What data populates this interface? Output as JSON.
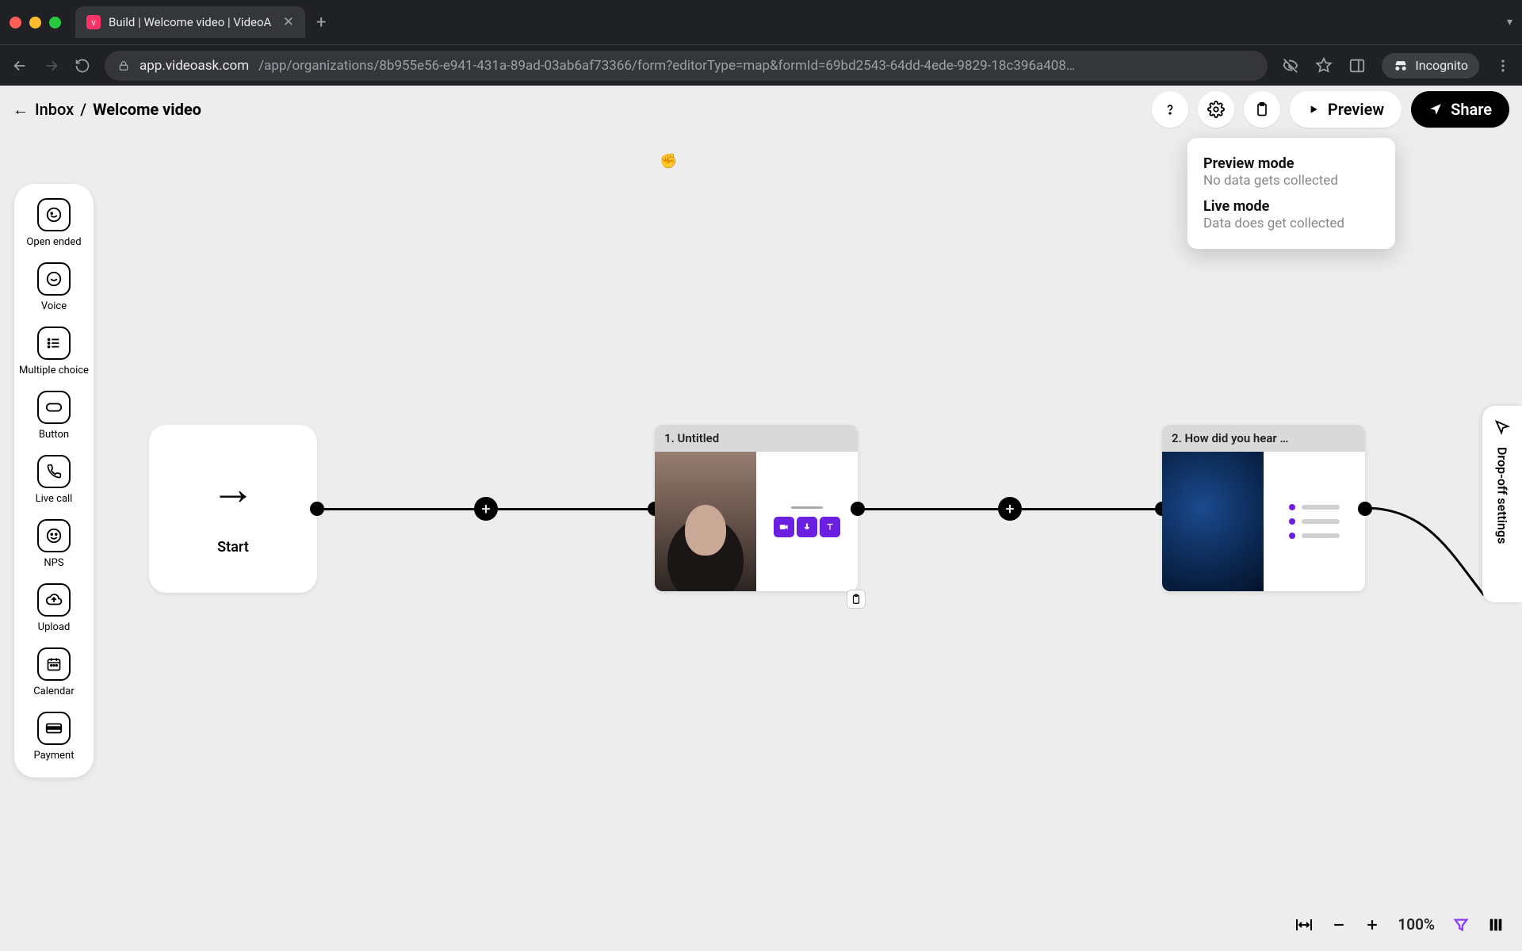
{
  "browser": {
    "tab_title": "Build | Welcome video | VideoA",
    "url_host": "app.videoask.com",
    "url_path": "/app/organizations/8b955e56-e941-431a-89ad-03ab6af73366/form?editorType=map&formId=69bd2543-64dd-4ede-9829-18c396a408…",
    "incognito_label": "Incognito"
  },
  "header": {
    "crumb_parent": "Inbox",
    "crumb_sep": "/",
    "page_title": "Welcome video",
    "preview_label": "Preview",
    "share_label": "Share"
  },
  "dropdown": {
    "preview_title": "Preview mode",
    "preview_sub": "No data gets collected",
    "live_title": "Live mode",
    "live_sub": "Data does get collected"
  },
  "tools": [
    {
      "id": "open-ended",
      "label": "Open ended"
    },
    {
      "id": "voice",
      "label": "Voice"
    },
    {
      "id": "multiple-choice",
      "label": "Multiple choice"
    },
    {
      "id": "button",
      "label": "Button"
    },
    {
      "id": "live-call",
      "label": "Live call"
    },
    {
      "id": "nps",
      "label": "NPS"
    },
    {
      "id": "upload",
      "label": "Upload"
    },
    {
      "id": "calendar",
      "label": "Calendar"
    },
    {
      "id": "payment",
      "label": "Payment"
    }
  ],
  "canvas": {
    "start_label": "Start",
    "step1_title": "1. Untitled",
    "step2_title": "2. How did you hear …"
  },
  "dropoff_label": "Drop-off settings",
  "zoom": {
    "value": "100%"
  }
}
